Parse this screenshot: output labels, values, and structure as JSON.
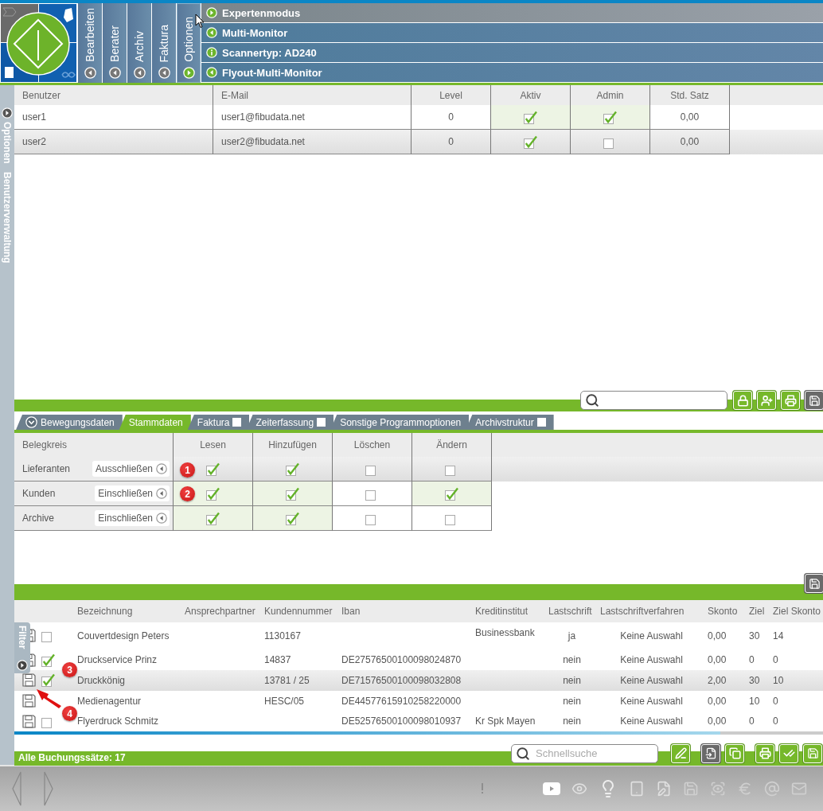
{
  "menu": {
    "tabs": [
      {
        "label": "Bearbeiten",
        "selected": false
      },
      {
        "label": "Berater",
        "selected": false
      },
      {
        "label": "Archiv",
        "selected": false
      },
      {
        "label": "Faktura",
        "selected": false
      },
      {
        "label": "Optionen",
        "selected": true
      }
    ]
  },
  "flyout": [
    {
      "label": "Expertenmodus",
      "kind": "action",
      "highlighted": true
    },
    {
      "label": "Multi-Monitor",
      "kind": "back",
      "highlighted": false
    },
    {
      "label": "Scannertyp: AD240",
      "kind": "info",
      "highlighted": false
    },
    {
      "label": "Flyout-Multi-Monitor",
      "kind": "back",
      "highlighted": false
    }
  ],
  "sidebar": {
    "labels": [
      "Optionen",
      "Benutzerverwaltung"
    ]
  },
  "users": {
    "columns": [
      "Benutzer",
      "E-Mail",
      "Level",
      "Aktiv",
      "Admin",
      "Std. Satz"
    ],
    "rows": [
      {
        "user": "user1",
        "email": "user1@fibudata.net",
        "user_level": "0",
        "active": true,
        "admin": true,
        "rate": "0,00",
        "selected": false
      },
      {
        "user": "user2",
        "email": "user2@fibudata.net",
        "user_level": "0",
        "active": true,
        "admin": false,
        "rate": "0,00",
        "selected": true
      }
    ]
  },
  "rights_tabs": [
    {
      "label": "Bewegungsdaten",
      "kind": "collapse",
      "selected": false
    },
    {
      "label": "Stammdaten",
      "kind": "plain",
      "selected": true
    },
    {
      "label": "Faktura",
      "kind": "checkbox",
      "checked": false,
      "selected": false
    },
    {
      "label": "Zeiterfassung",
      "kind": "checkbox",
      "checked": false,
      "selected": false
    },
    {
      "label": "Sonstige Programmoptionen",
      "kind": "plain",
      "selected": false
    },
    {
      "label": "Archivstruktur",
      "kind": "checkbox",
      "checked": false,
      "selected": false
    }
  ],
  "rights": {
    "columns": [
      "Belegkreis",
      "Lesen",
      "Hinzufügen",
      "Löschen",
      "Ändern"
    ],
    "rows": [
      {
        "name": "Lieferanten",
        "mode": "Ausschließen",
        "read": true,
        "add": true,
        "delete": false,
        "change": false,
        "selected": true
      },
      {
        "name": "Kunden",
        "mode": "Einschließen",
        "read": true,
        "add": true,
        "delete": false,
        "change": true,
        "selected": false
      },
      {
        "name": "Archive",
        "mode": "Einschließen",
        "read": true,
        "add": true,
        "delete": false,
        "change": false,
        "selected": false
      }
    ]
  },
  "customers": {
    "columns": [
      "Bezeichnung",
      "Ansprechpartner",
      "Kundennummer",
      "Iban",
      "Kreditinstitut",
      "Lastschrift",
      "Lastschriftverfahren",
      "Skonto",
      "Ziel",
      "Ziel Skonto"
    ],
    "rows": [
      {
        "name": "Couvertdesign Peters",
        "number": "1130167",
        "bank": "Businessbank",
        "debit": "ja",
        "method": "Keine Auswahl",
        "discount": "0,00",
        "term": "30",
        "discount_term": "14",
        "checked": false,
        "selected": false
      },
      {
        "name": "Druckservice Prinz",
        "number": "14837",
        "iban": "DE27576500100098024870",
        "debit": "nein",
        "method": "Keine Auswahl",
        "discount": "0,00",
        "term": "0",
        "discount_term": "0",
        "checked": true,
        "selected": false
      },
      {
        "name": "Druckkönig",
        "number": "13781 / 25",
        "iban": "DE71576500100098032808",
        "debit": "nein",
        "method": "Keine Auswahl",
        "discount": "2,00",
        "term": "30",
        "discount_term": "10",
        "checked": true,
        "selected": true
      },
      {
        "name": "Medienagentur",
        "number": "HESC/05",
        "iban": "DE44577615910258220000",
        "debit": "nein",
        "method": "Keine Auswahl",
        "discount": "0,00",
        "term": "10",
        "discount_term": "0",
        "selected": false
      },
      {
        "name": "Flyerdruck Schmitz",
        "iban": "DE52576500100098010937",
        "bank": "Kr Spk Mayen",
        "debit": "nein",
        "method": "Keine Auswahl",
        "discount": "0,00",
        "term": "0",
        "discount_term": "0",
        "checked": false,
        "selected": false
      }
    ]
  },
  "filter_tab": {
    "label": "Filter"
  },
  "quick_search": {
    "placeholder": "Schnellsuche"
  },
  "status": "Alle Buchungssätze: 17",
  "annotations": [
    "1",
    "2",
    "3",
    "4"
  ]
}
